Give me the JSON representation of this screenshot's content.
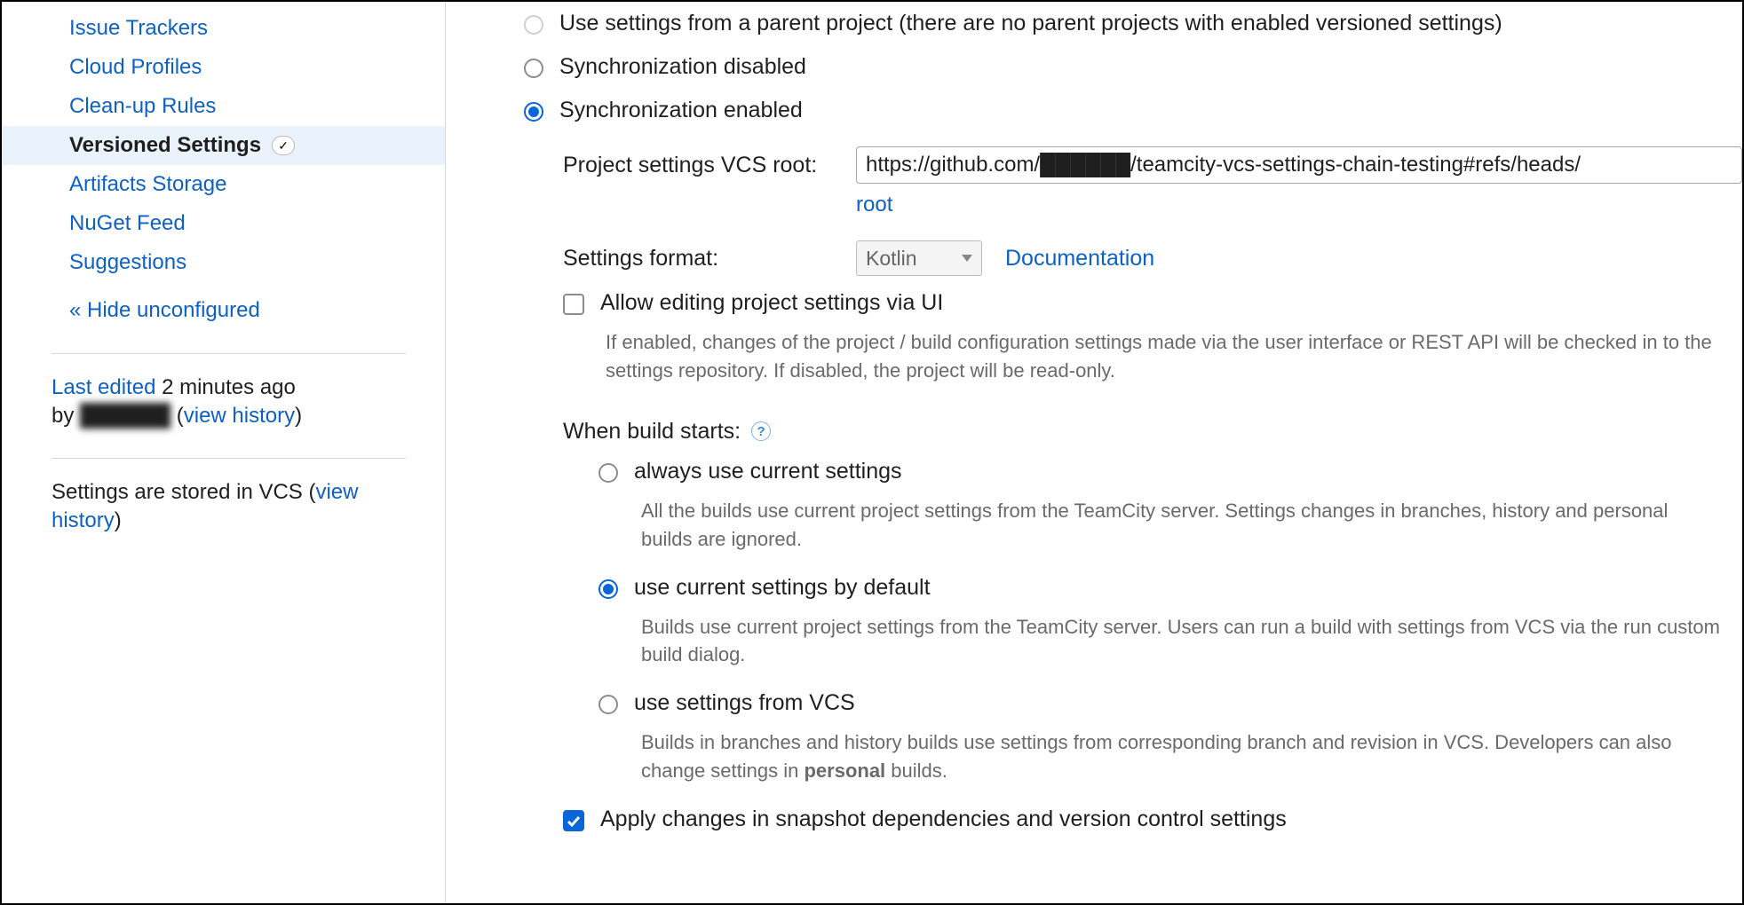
{
  "sidebar": {
    "items": [
      {
        "label": "Issue Trackers"
      },
      {
        "label": "Cloud Profiles"
      },
      {
        "label": "Clean-up Rules"
      },
      {
        "label": "Versioned Settings",
        "active": true
      },
      {
        "label": "Artifacts Storage"
      },
      {
        "label": "NuGet Feed"
      },
      {
        "label": "Suggestions"
      }
    ],
    "hide_link": "« Hide unconfigured",
    "last_edited_label": "Last edited",
    "last_edited_time": "2 minutes ago",
    "last_edited_by_label": "by",
    "last_edited_user": "██████",
    "view_history": "view history",
    "stored_text_a": "Settings are stored in VCS (",
    "stored_text_b": ")"
  },
  "sync": {
    "opt_parent": "Use settings from a parent project (there are no parent projects with enabled versioned settings)",
    "opt_disabled": "Synchronization disabled",
    "opt_enabled": "Synchronization enabled",
    "vcs_root_label": "Project settings VCS root:",
    "vcs_root_value": "https://github.com/██████/teamcity-vcs-settings-chain-testing#refs/heads/",
    "vcs_root_link": "root",
    "format_label": "Settings format:",
    "format_value": "Kotlin",
    "documentation": "Documentation",
    "allow_edit_label": "Allow editing project settings via UI",
    "allow_edit_desc": "If enabled, changes of the project / build configuration settings made via the user interface or REST API will be checked in to the settings repository. If disabled, the project will be read-only.",
    "when_build_label": "When build starts:",
    "wb_opt1": "always use current settings",
    "wb_opt1_desc": "All the builds use current project settings from the TeamCity server. Settings changes in branches, history and personal builds are ignored.",
    "wb_opt2": "use current settings by default",
    "wb_opt2_desc": "Builds use current project settings from the TeamCity server. Users can run a build with settings from VCS via the run custom build dialog.",
    "wb_opt3": "use settings from VCS",
    "wb_opt3_desc_a": "Builds in branches and history builds use settings from corresponding branch and revision in VCS. Developers can also change settings in ",
    "wb_opt3_desc_bold": "personal",
    "wb_opt3_desc_b": " builds.",
    "apply_chk": "Apply changes in snapshot dependencies and version control settings"
  }
}
